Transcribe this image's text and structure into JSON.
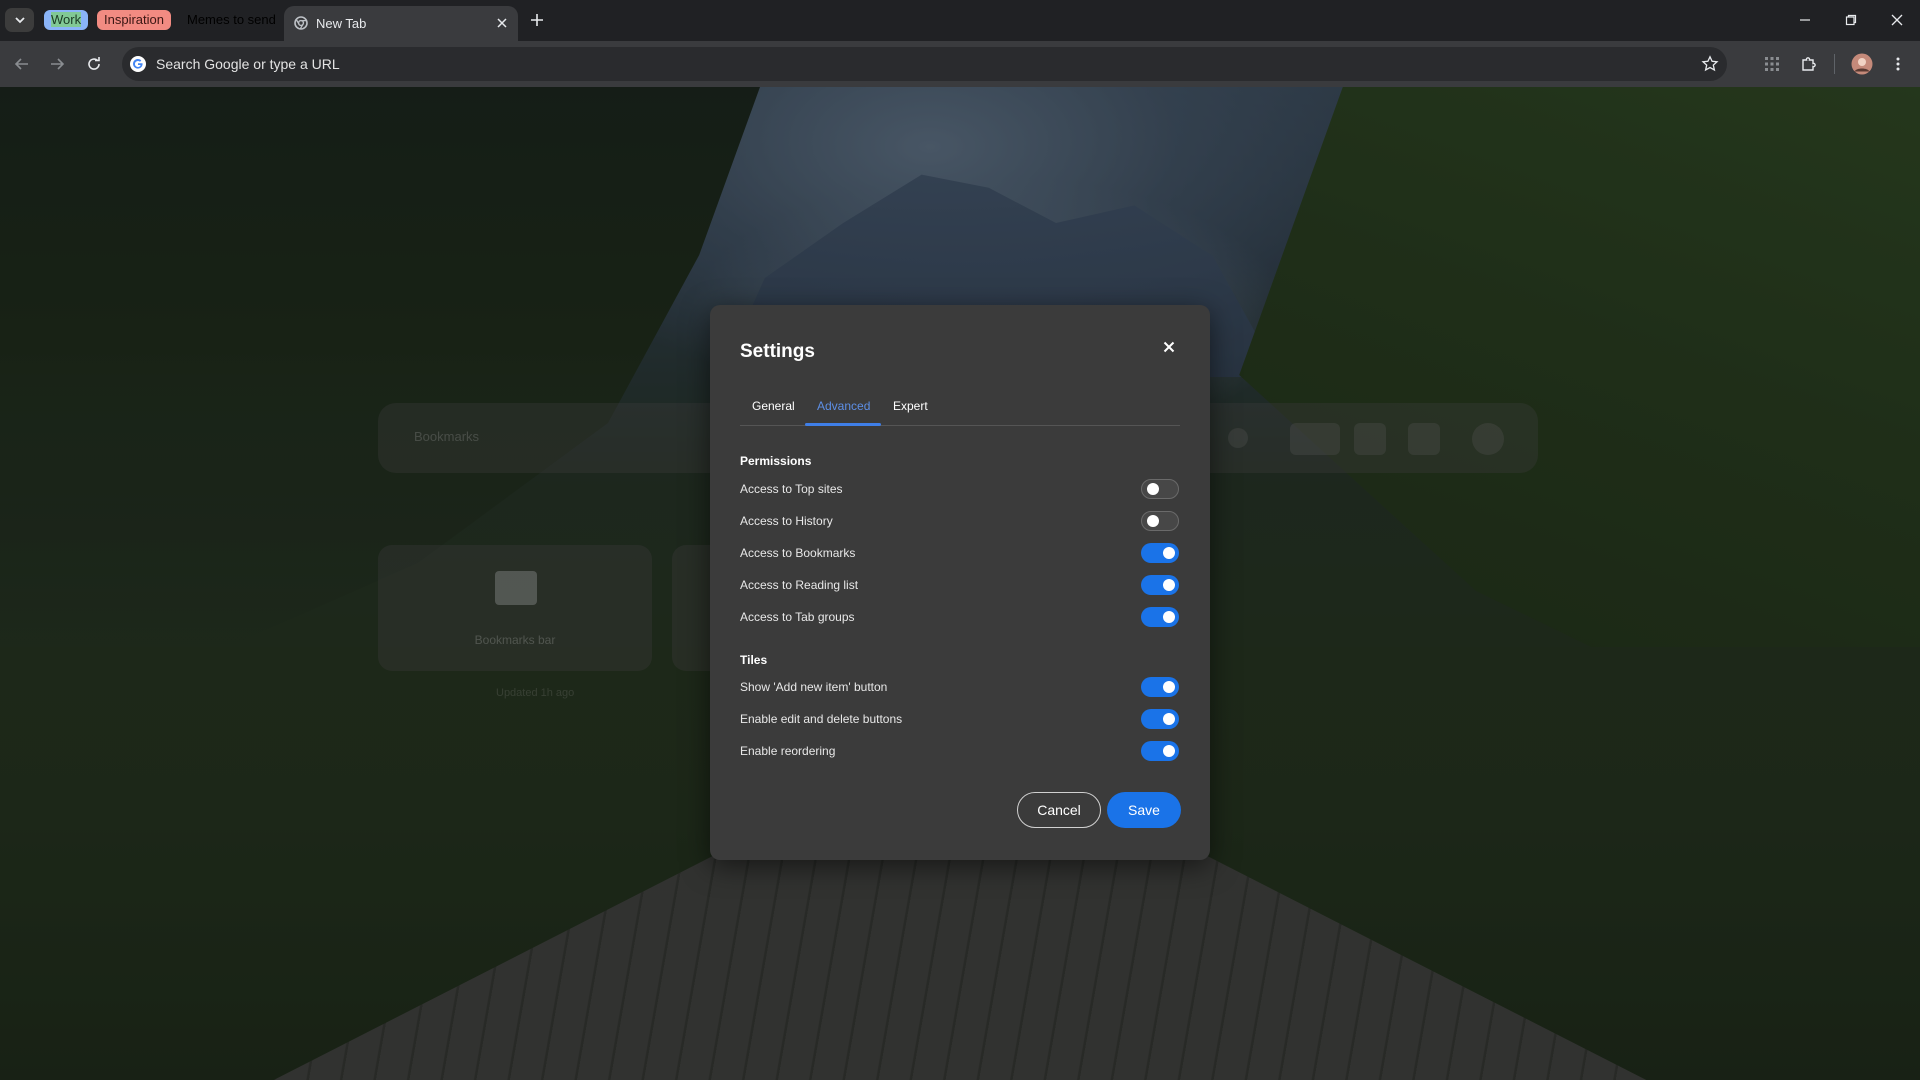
{
  "browser": {
    "tab_groups": [
      {
        "label": "Work",
        "color": "#8ab4f8",
        "text_color": "#1f2a44"
      },
      {
        "label": "Inspiration",
        "color": "#81c995",
        "text_color": "#1b3a24"
      },
      {
        "label": "Memes to send",
        "color": "#f28b82",
        "text_color": "#3c1714"
      }
    ],
    "active_tab": {
      "title": "New Tab"
    },
    "omnibox": {
      "placeholder": "Search Google or type a URL"
    }
  },
  "ntp_background": {
    "ghost_search_text": "Bookmarks",
    "ghost_tile_label": "Bookmarks bar",
    "ghost_sub_text": "Updated 1h ago"
  },
  "settings_dialog": {
    "title": "Settings",
    "tabs": [
      {
        "label": "General",
        "active": false
      },
      {
        "label": "Advanced",
        "active": true
      },
      {
        "label": "Expert",
        "active": false
      }
    ],
    "sections": {
      "permissions": {
        "title": "Permissions",
        "items": [
          {
            "label": "Access to Top sites",
            "enabled": false
          },
          {
            "label": "Access to History",
            "enabled": false
          },
          {
            "label": "Access to Bookmarks",
            "enabled": true
          },
          {
            "label": "Access to Reading list",
            "enabled": true
          },
          {
            "label": "Access to Tab groups",
            "enabled": true
          }
        ]
      },
      "tiles": {
        "title": "Tiles",
        "items": [
          {
            "label": "Show 'Add new item' button",
            "enabled": true
          },
          {
            "label": "Enable edit and delete buttons",
            "enabled": true
          },
          {
            "label": "Enable reordering",
            "enabled": true
          }
        ]
      }
    },
    "cancel_label": "Cancel",
    "save_label": "Save"
  },
  "colors": {
    "accent": "#1a73e8",
    "dialog_bg": "#3b3b3b",
    "active_tab_text": "#5d8fe6"
  }
}
